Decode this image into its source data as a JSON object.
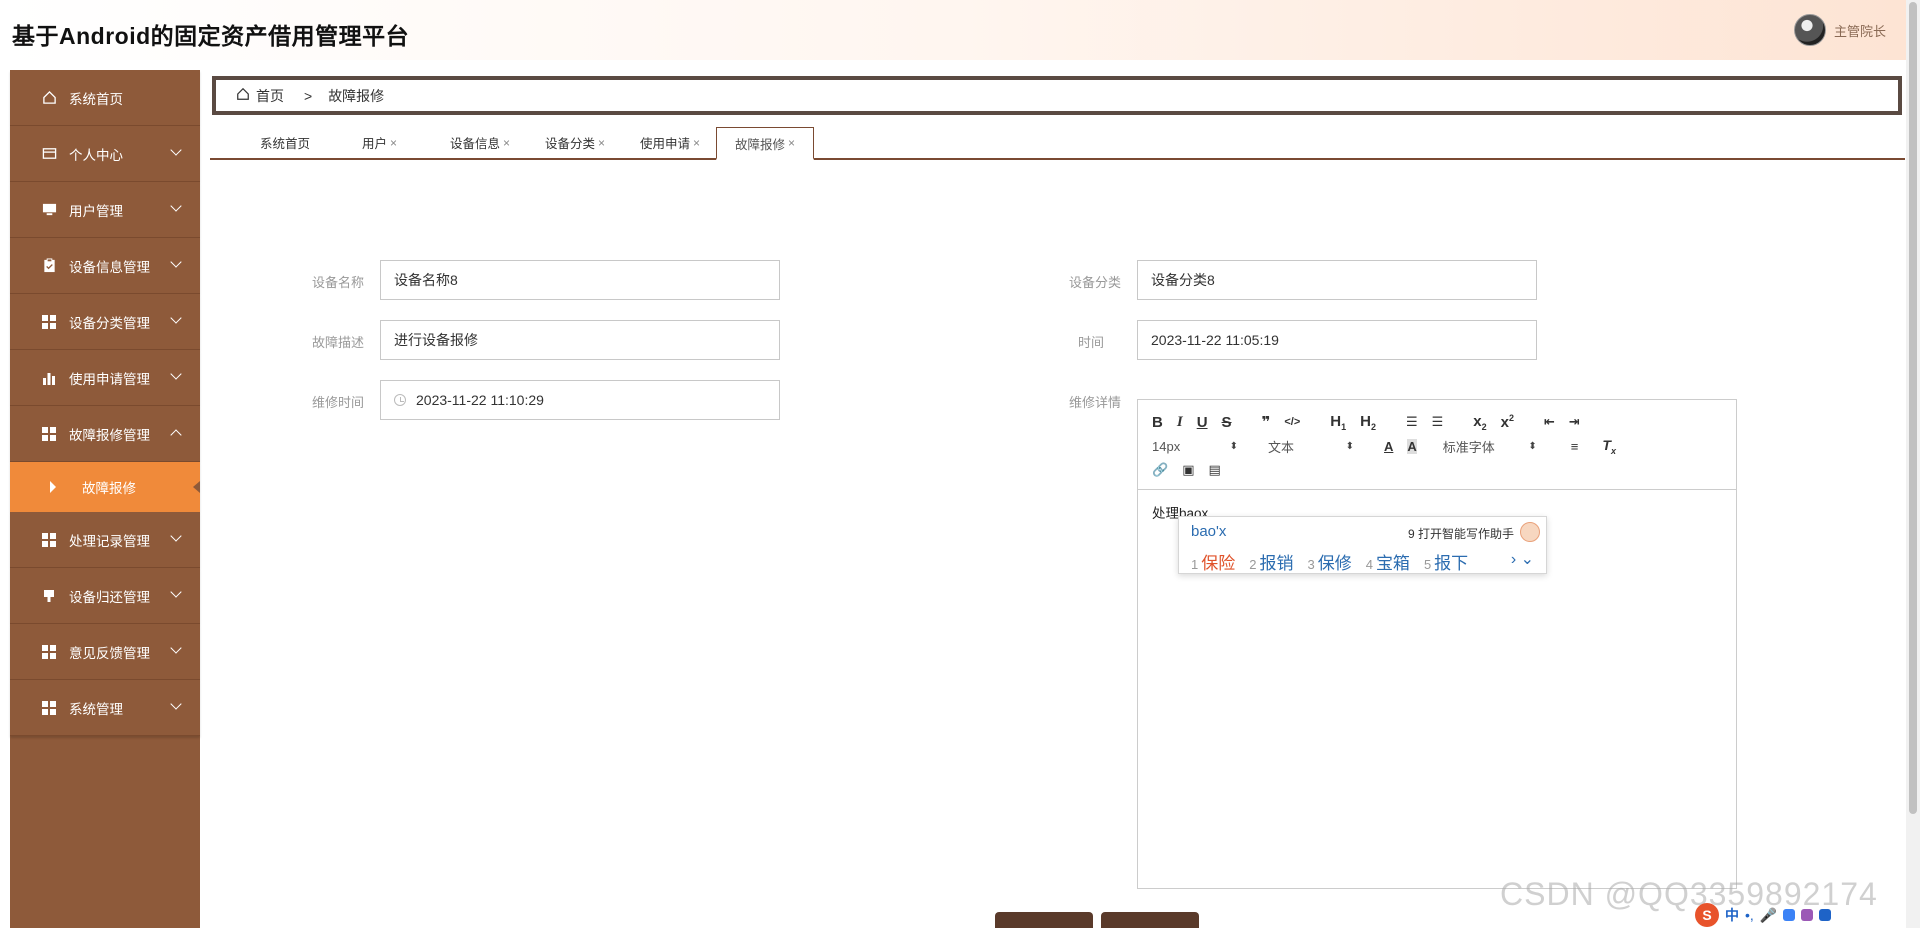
{
  "header": {
    "title": "基于Android的固定资产借用管理平台",
    "user_name": "主管院长"
  },
  "sidebar": {
    "items": [
      {
        "label": "系统首页",
        "icon": "home-icon",
        "expand": ""
      },
      {
        "label": "个人中心",
        "icon": "card-icon",
        "expand": "down"
      },
      {
        "label": "用户管理",
        "icon": "monitor-icon",
        "expand": "down"
      },
      {
        "label": "设备信息管理",
        "icon": "clipboard-icon",
        "expand": "down"
      },
      {
        "label": "设备分类管理",
        "icon": "grid-icon",
        "expand": "down"
      },
      {
        "label": "使用申请管理",
        "icon": "bar-chart-icon",
        "expand": "down"
      },
      {
        "label": "故障报修管理",
        "icon": "grid-icon",
        "expand": "up"
      },
      {
        "label": "故障报修",
        "icon": "triangle-right-icon",
        "expand": "",
        "sub": true,
        "active": true
      },
      {
        "label": "处理记录管理",
        "icon": "grid-icon",
        "expand": "down"
      },
      {
        "label": "设备归还管理",
        "icon": "pin-icon",
        "expand": "down"
      },
      {
        "label": "意见反馈管理",
        "icon": "grid-icon",
        "expand": "down"
      },
      {
        "label": "系统管理",
        "icon": "grid-icon",
        "expand": "down"
      }
    ]
  },
  "breadcrumb": {
    "home": "首页",
    "separator": ">",
    "current": "故障报修"
  },
  "tabs": [
    {
      "label": "系统首页",
      "closable": false
    },
    {
      "label": "用户",
      "closable": true
    },
    {
      "label": "设备信息",
      "closable": true
    },
    {
      "label": "设备分类",
      "closable": true
    },
    {
      "label": "使用申请",
      "closable": true
    },
    {
      "label": "故障报修",
      "closable": true,
      "active": true
    }
  ],
  "tab_close": "×",
  "form": {
    "device_name": {
      "label": "设备名称",
      "value": "设备名称8"
    },
    "device_category": {
      "label": "设备分类",
      "value": "设备分类8"
    },
    "fault_desc": {
      "label": "故障描述",
      "value": "进行设备报修"
    },
    "time": {
      "label": "时间",
      "value": "2023-11-22 11:05:19"
    },
    "repair_time": {
      "label": "维修时间",
      "value": "2023-11-22 11:10:29"
    },
    "repair_detail": {
      "label": "维修详情"
    }
  },
  "editor": {
    "font_size": "14px",
    "block_type": "文本",
    "font_family": "标准字体",
    "content_prefix": "处理",
    "content_composing": "baox"
  },
  "ime": {
    "pinyin": "bao'x",
    "hint": "9 打开智能写作助手",
    "candidates": [
      {
        "n": "1",
        "text": "保险"
      },
      {
        "n": "2",
        "text": "报销"
      },
      {
        "n": "3",
        "text": "保修"
      },
      {
        "n": "4",
        "text": "宝箱"
      },
      {
        "n": "5",
        "text": "报下"
      }
    ],
    "nav": "› ⌄"
  },
  "watermark": "CSDN @QQ3359892174",
  "tray": {
    "lang": "中"
  }
}
